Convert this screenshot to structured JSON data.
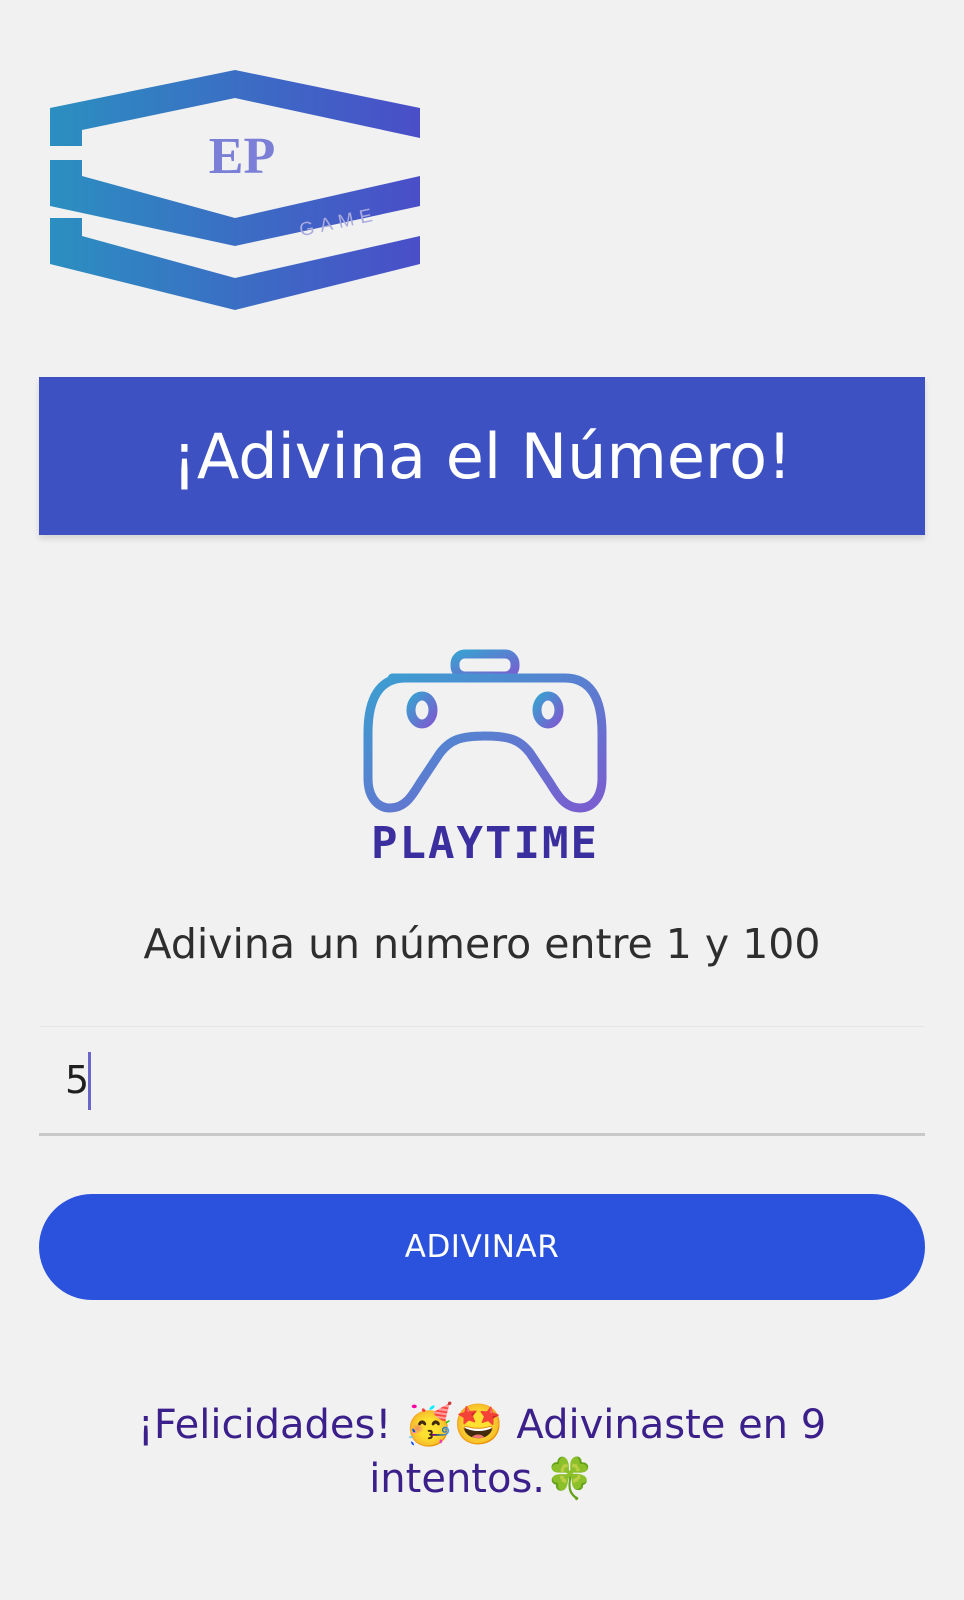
{
  "brand": {
    "logo_text": "EP",
    "logo_subtext": "GAME"
  },
  "header": {
    "title": "¡Adivina el Número!"
  },
  "playtime_logo": {
    "text": "PLAYTIME",
    "icon": "gamepad-icon"
  },
  "game": {
    "instruction": "Adivina un número entre 1 y 100",
    "input_value": "5",
    "button_label": "ADIVINAR",
    "result_message": "¡Felicidades! 🥳🤩 Adivinaste en 9 intentos.🍀"
  },
  "colors": {
    "primary": "#3d51c2",
    "button": "#2a52dc",
    "result_text": "#3b1f8a",
    "background": "#f1f1f1"
  }
}
